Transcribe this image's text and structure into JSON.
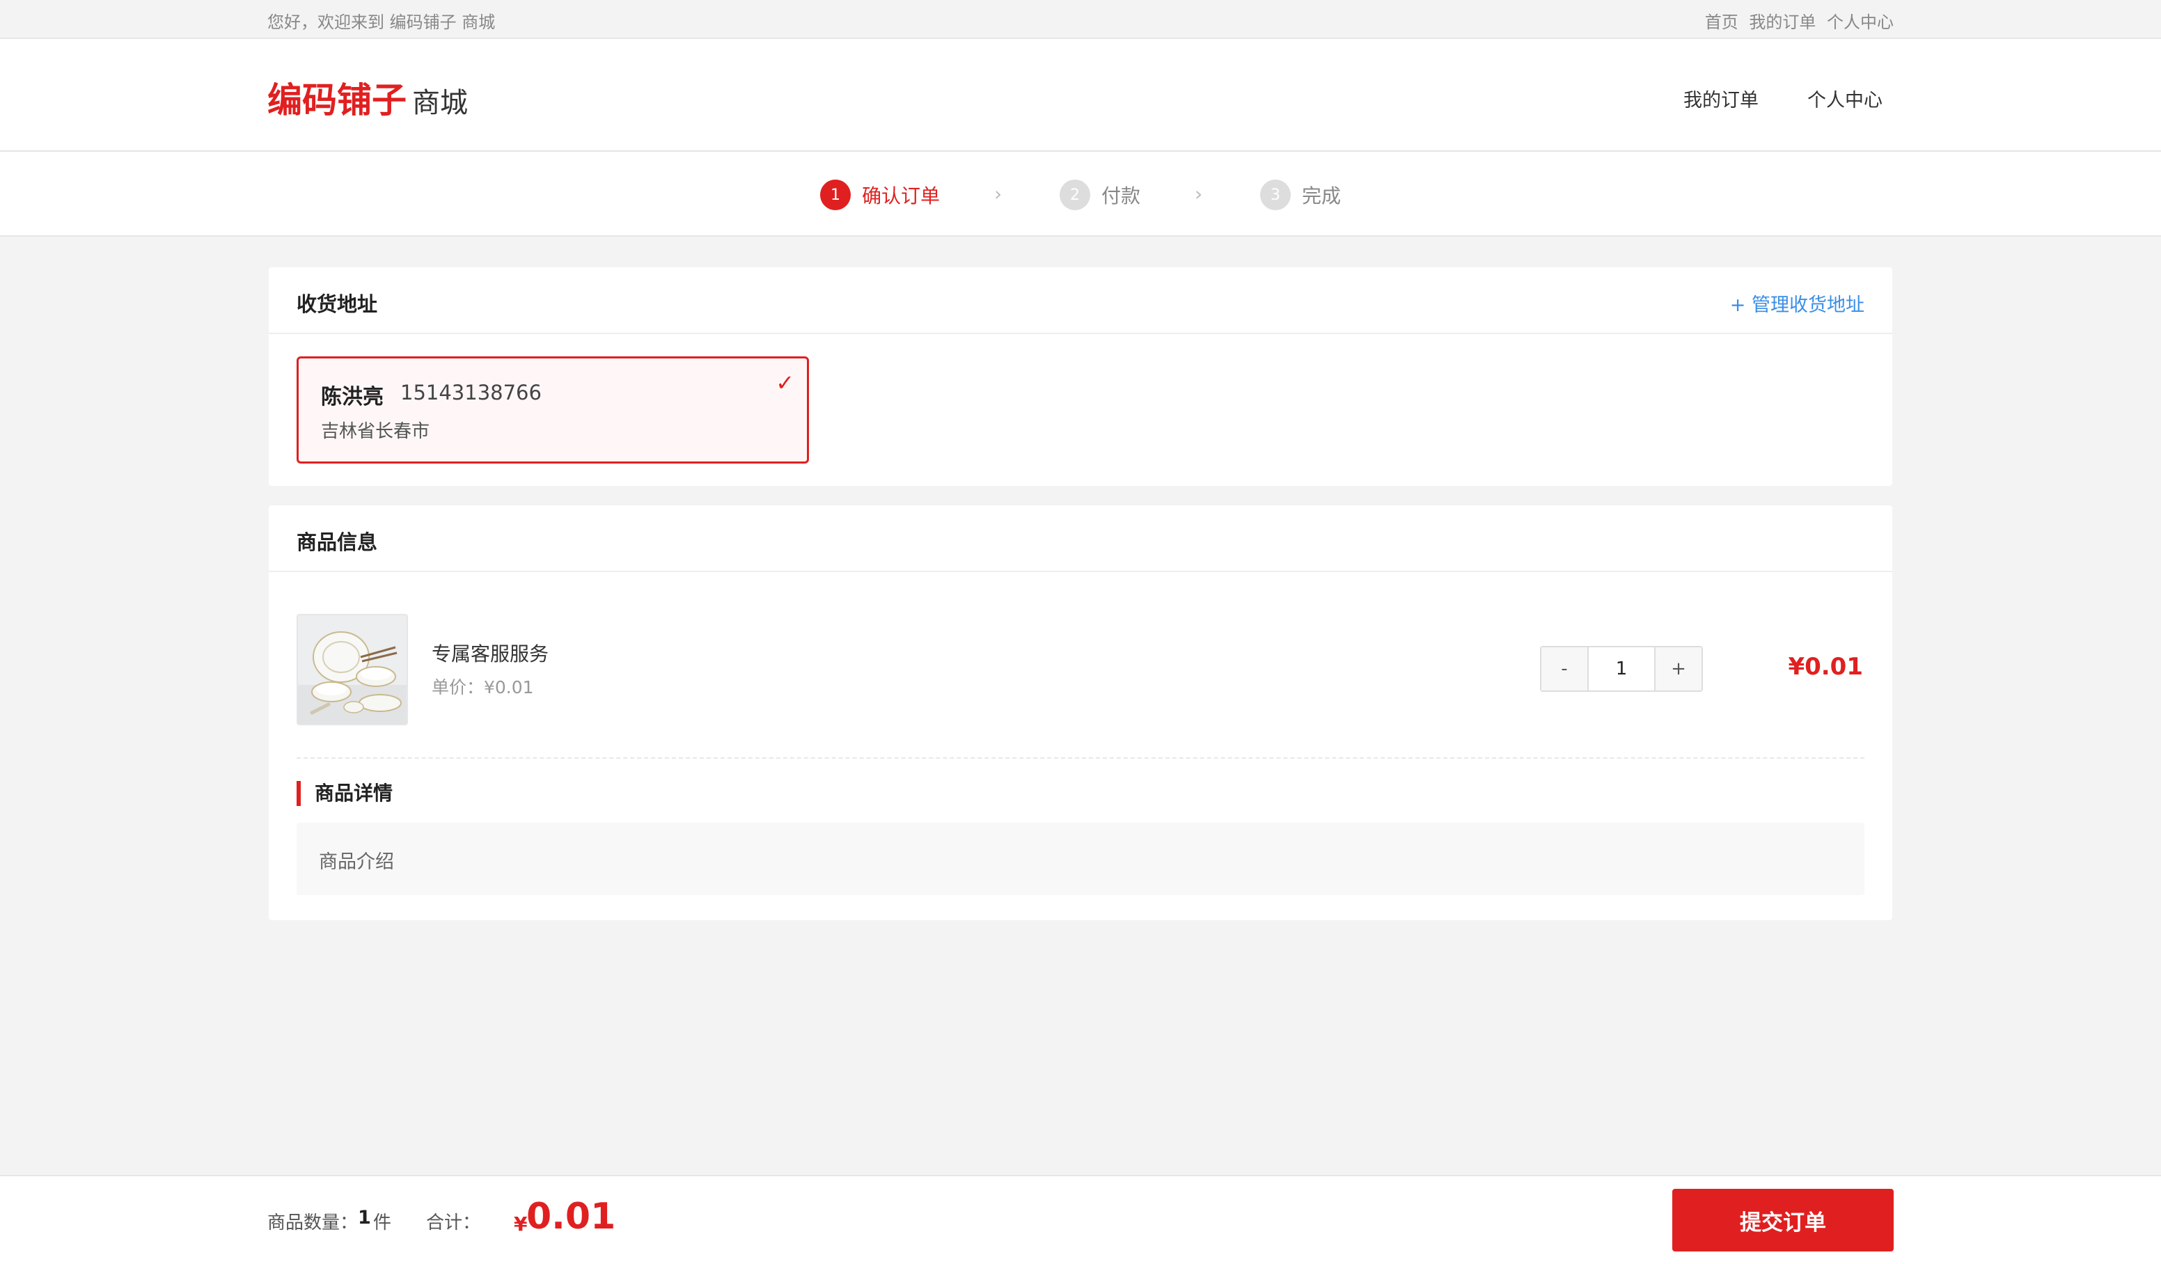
{
  "topbar": {
    "welcome": "您好，欢迎来到 编码铺子 商城",
    "links": [
      "首页",
      "我的订单",
      "个人中心"
    ]
  },
  "header": {
    "brand": "编码铺子",
    "brand_suffix": "商城",
    "nav": [
      "我的订单",
      "个人中心"
    ]
  },
  "steps": [
    {
      "num": "1",
      "label": "确认订单",
      "active": true
    },
    {
      "num": "2",
      "label": "付款",
      "active": false
    },
    {
      "num": "3",
      "label": "完成",
      "active": false
    }
  ],
  "step_separator": "›",
  "address": {
    "title": "收货地址",
    "manage_label": "+ 管理收货地址",
    "name": "陈洪亮",
    "phone": "15143138766",
    "line": "吉林省长春市",
    "check": "✓"
  },
  "goods": {
    "title": "商品信息",
    "name": "专属客服服务",
    "unit_price": "单价：¥0.01",
    "quantity": "1",
    "minus": "-",
    "plus": "+",
    "subtotal": "¥0.01",
    "detail_title": "商品详情",
    "detail_text": "商品介绍"
  },
  "footer": {
    "qty_label": "商品数量：",
    "qty_value": "1",
    "qty_unit": "件",
    "total_label": "合计：",
    "currency": "¥",
    "total_amount": "0.01",
    "submit_label": "提交订单"
  },
  "colors": {
    "accent": "#e02020",
    "link": "#3a8ee6",
    "background": "#f3f3f3"
  }
}
